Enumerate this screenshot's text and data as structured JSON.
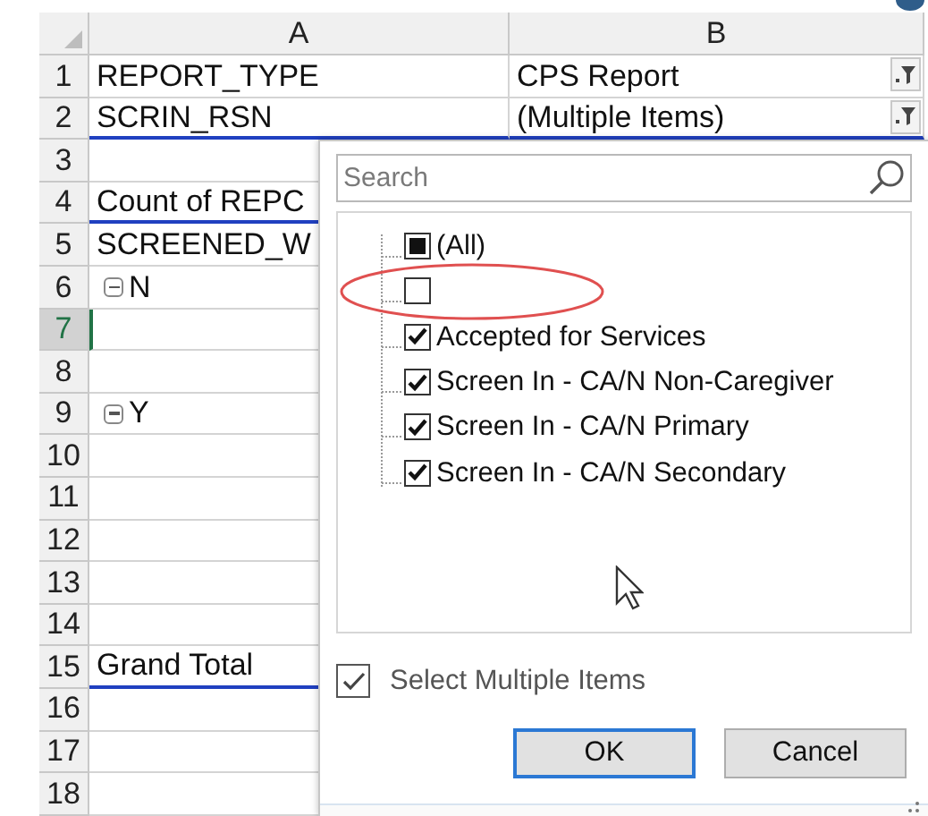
{
  "columns": [
    {
      "label": "A"
    },
    {
      "label": "B"
    }
  ],
  "rows": [
    {
      "number": "1",
      "a": "REPORT_TYPE",
      "b": "CPS Report",
      "filter": true,
      "underline": false,
      "selected": false
    },
    {
      "number": "2",
      "a": "SCRIN_RSN",
      "b": "(Multiple Items)",
      "filter": true,
      "underline": true,
      "selected": false
    },
    {
      "number": "3",
      "underline": false,
      "selected": false
    },
    {
      "number": "4",
      "a": "Count of REPC",
      "underline": true,
      "selected": false
    },
    {
      "number": "5",
      "a": "SCREENED_W",
      "underline": false,
      "selected": false
    },
    {
      "number": "6",
      "a": "N",
      "expanded": true,
      "underline": false,
      "selected": false
    },
    {
      "number": "7",
      "underline": false,
      "selected": true
    },
    {
      "number": "8",
      "underline": false,
      "selected": false
    },
    {
      "number": "9",
      "a": "Y",
      "expanded": true,
      "underline": false,
      "selected": false
    },
    {
      "number": "10",
      "underline": false,
      "selected": false
    },
    {
      "number": "11",
      "underline": false,
      "selected": false
    },
    {
      "number": "12",
      "underline": false,
      "selected": false
    },
    {
      "number": "13",
      "underline": false,
      "selected": false
    },
    {
      "number": "14",
      "underline": false,
      "selected": false
    },
    {
      "number": "15",
      "a": "Grand Total",
      "underline": true,
      "selected": false
    },
    {
      "number": "16",
      "underline": false,
      "selected": false
    },
    {
      "number": "17",
      "underline": false,
      "selected": false
    },
    {
      "number": "18",
      "underline": false,
      "selected": false
    }
  ],
  "filter_popup": {
    "search": {
      "placeholder": "Search"
    },
    "items": [
      {
        "label": "(All)",
        "checked": false,
        "partial": true,
        "circled": false
      },
      {
        "checked": false,
        "partial": false,
        "circled": true
      },
      {
        "label": "Accepted for Services",
        "checked": true,
        "partial": false,
        "circled": false
      },
      {
        "label": "Screen In - CA/N Non-Caregiver",
        "checked": true,
        "partial": false,
        "circled": false
      },
      {
        "label": "Screen In - CA/N Primary",
        "checked": true,
        "partial": false,
        "circled": false
      },
      {
        "label": "Screen In - CA/N Secondary",
        "checked": true,
        "partial": false,
        "circled": false
      }
    ],
    "select_multiple": {
      "label": "Select Multiple Items",
      "checked": true
    },
    "buttons": [
      {
        "label": "OK",
        "default": true
      },
      {
        "label": "Cancel",
        "default": false
      }
    ]
  }
}
